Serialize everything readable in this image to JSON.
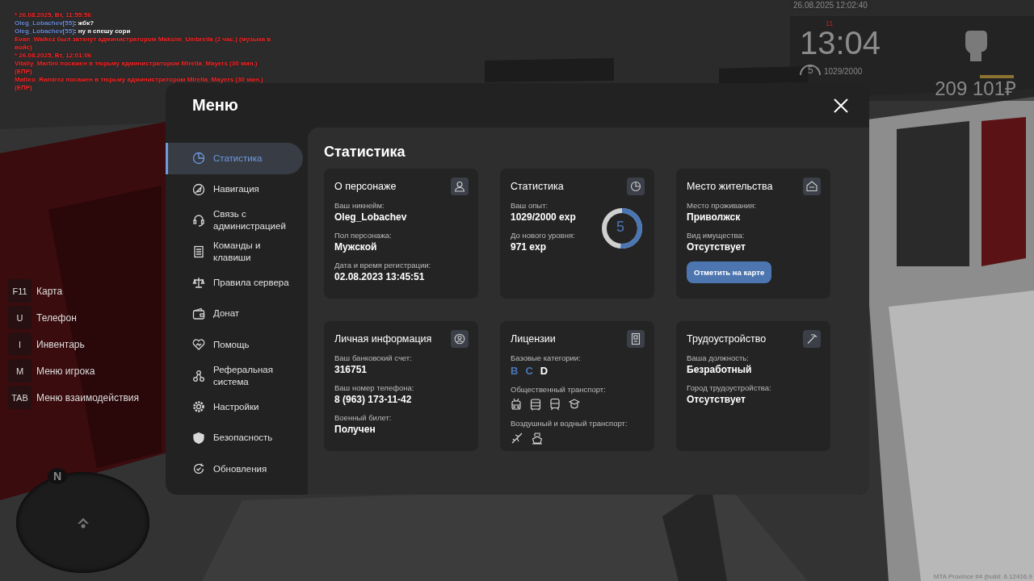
{
  "chat": [
    {
      "parts": [
        {
          "text": "* 26.08.2025, Вт, 11:55:56",
          "color": "#ff2a2a"
        }
      ]
    },
    {
      "parts": [
        {
          "text": "Oleg_Lobachev[55]",
          "color": "#6f8fdc"
        },
        {
          "text": ": жбк?",
          "color": "#ffffff"
        }
      ]
    },
    {
      "parts": [
        {
          "text": "Oleg_Lobachev[55]",
          "color": "#6f8fdc"
        },
        {
          "text": ": ну я спешу сори",
          "color": "#ffffff"
        }
      ]
    },
    {
      "parts": [
        {
          "text": "Evan_Walkez был заткнут администратором Maksim_Umbrella (2 час.) (музыка в войс)",
          "color": "#ff2a2a"
        }
      ]
    },
    {
      "parts": [
        {
          "text": "* 26.08.2025, Вт, 12:01:06",
          "color": "#ff2a2a"
        }
      ]
    },
    {
      "parts": [
        {
          "text": "Vitaliy_Martini посажен в тюрьму администратором Mirella_Mayers (30 мин.) (ЕПР)",
          "color": "#ff2a2a"
        }
      ]
    },
    {
      "parts": [
        {
          "text": "Matteo_Ramirez посажен в тюрьму администратором Mirella_Mayers (30 мин.) (ЕПР)",
          "color": "#ff2a2a"
        }
      ]
    }
  ],
  "hud": {
    "date": "26.08.2025 12:02:40",
    "marker": "11",
    "clock": "13:04",
    "exp_ring": {
      "value": "5"
    },
    "experience": "1029/2000",
    "money": "209 101₽"
  },
  "key_hints": [
    {
      "key": "F11",
      "label": "Карта"
    },
    {
      "key": "U",
      "label": "Телефон"
    },
    {
      "key": "I",
      "label": "Инвентарь"
    },
    {
      "key": "M",
      "label": "Меню игрока"
    },
    {
      "key": "TAB",
      "label": "Меню взаимодействия"
    }
  ],
  "minimap": {
    "north": "N"
  },
  "build": "MTA Province #4 (build: 6.12416.9",
  "menu": {
    "title": "Меню",
    "sidebar": [
      {
        "label": "Статистика",
        "selected": true
      },
      {
        "label": "Навигация",
        "selected": false
      },
      {
        "label": "Связь с администрацией",
        "selected": false
      },
      {
        "label": "Команды и клавиши",
        "selected": false
      },
      {
        "label": "Правила сервера",
        "selected": false
      },
      {
        "label": "Донат",
        "selected": false
      },
      {
        "label": "Помощь",
        "selected": false
      },
      {
        "label": "Реферальная система",
        "selected": false
      },
      {
        "label": "Настройки",
        "selected": false
      },
      {
        "label": "Безопасность",
        "selected": false
      },
      {
        "label": "Обновления",
        "selected": false
      }
    ],
    "heading": "Статистика",
    "cards": [
      {
        "title": "О персонаже",
        "fields": [
          {
            "label": "Ваш никнейм:",
            "value": "Oleg_Lobachev"
          },
          {
            "label": "Пол персонажа:",
            "value": "Мужской"
          },
          {
            "label": "Дата и время регистрации:",
            "value": "02.08.2023 13:45:51"
          }
        ]
      },
      {
        "title": "Статистика",
        "fields": [
          {
            "label": "Ваш опыт:",
            "value": "1029/2000 exp"
          },
          {
            "label": "До нового уровня:",
            "value": "971 exp"
          }
        ],
        "ring": {
          "value": "5",
          "level": 0.51
        }
      },
      {
        "title": "Место жительства",
        "fields": [
          {
            "label": "Место проживания:",
            "value": "Приволжск"
          },
          {
            "label": "Вид имущества:",
            "value": "Отсутствует"
          }
        ],
        "button": "Отметить на карте"
      },
      {
        "title": "Личная информация",
        "fields": [
          {
            "label": "Ваш банковский счет:",
            "value": "316751"
          },
          {
            "label": "Ваш номер телефона:",
            "value": "8 (963) 173-11-42"
          },
          {
            "label": "Военный билет:",
            "value": "Получен"
          }
        ]
      },
      {
        "title": "Лицензии",
        "groups": [
          {
            "label": "Базовые категории:",
            "kind": "letters",
            "letters": [
              {
                "text": "B",
                "active": true
              },
              {
                "text": "C",
                "active": true
              },
              {
                "text": "D",
                "active": false
              }
            ]
          },
          {
            "label": "Общественный транспорт:",
            "kind": "ground"
          },
          {
            "label": "Воздушный и водный транспорт:",
            "kind": "air-water"
          }
        ]
      },
      {
        "title": "Трудоустройство",
        "fields": [
          {
            "label": "Ваша должность:",
            "value": "Безработный"
          },
          {
            "label": "Город трудоустройства:",
            "value": "Отсутствует"
          }
        ]
      }
    ]
  }
}
